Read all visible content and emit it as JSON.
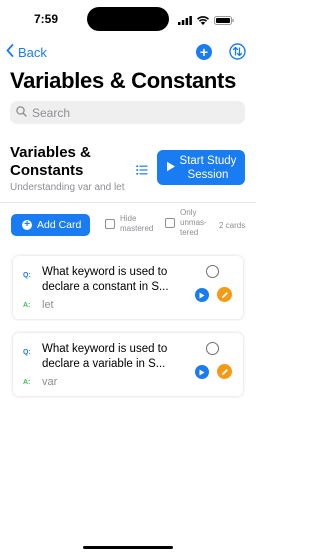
{
  "status_bar": {
    "time": "7:59"
  },
  "nav": {
    "back_label": "Back"
  },
  "page": {
    "title": "Variables & Constants"
  },
  "search": {
    "placeholder": "Search"
  },
  "deck": {
    "title": "Variables & Constants",
    "subtitle": "Understanding var and let",
    "study_button": "Start Study Session"
  },
  "toolbar": {
    "add_card": "Add Card",
    "hide_mastered": "Hide mastered",
    "only_unmastered": "Only unmas-tered",
    "count": "2 cards"
  },
  "cards": [
    {
      "q_marker": "Q:",
      "question": "What keyword is used to declare a constant in S...",
      "a_marker": "A:",
      "answer": "let"
    },
    {
      "q_marker": "Q:",
      "question": "What keyword is used to declare a variable in S...",
      "a_marker": "A:",
      "answer": "var"
    }
  ],
  "colors": {
    "accent": "#1a7cf2",
    "edit": "#f59a16",
    "answer_marker": "#34c759",
    "secondary_text": "#8e8e93"
  },
  "icons": [
    "signal-icon",
    "wifi-icon",
    "battery-icon",
    "chevron-left-icon",
    "plus-circle-icon",
    "swap-icon",
    "search-icon",
    "list-icon",
    "play-icon",
    "pencil-icon"
  ]
}
